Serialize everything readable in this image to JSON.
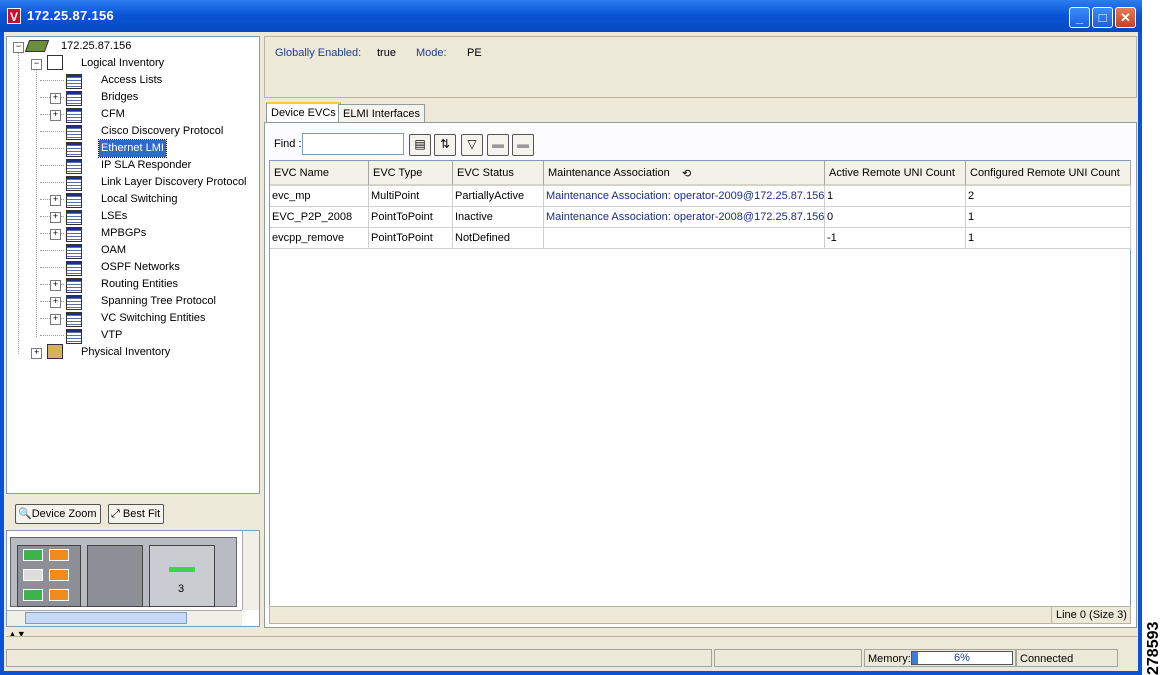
{
  "window": {
    "title": "172.25.87.156",
    "logo": "V"
  },
  "tree": {
    "root": "172.25.87.156",
    "logical": "Logical Inventory",
    "items": [
      {
        "label": "Access Lists",
        "expandable": false
      },
      {
        "label": "Bridges",
        "expandable": true
      },
      {
        "label": "CFM",
        "expandable": true
      },
      {
        "label": "Cisco Discovery Protocol",
        "expandable": false
      },
      {
        "label": "Ethernet LMI",
        "expandable": false,
        "selected": true
      },
      {
        "label": "IP SLA Responder",
        "expandable": false
      },
      {
        "label": "Link Layer Discovery Protocol",
        "expandable": false
      },
      {
        "label": "Local Switching",
        "expandable": true
      },
      {
        "label": "LSEs",
        "expandable": true
      },
      {
        "label": "MPBGPs",
        "expandable": true
      },
      {
        "label": "OAM",
        "expandable": false
      },
      {
        "label": "OSPF Networks",
        "expandable": false
      },
      {
        "label": "Routing Entities",
        "expandable": true
      },
      {
        "label": "Spanning Tree Protocol",
        "expandable": true
      },
      {
        "label": "VC Switching Entities",
        "expandable": true
      },
      {
        "label": "VTP",
        "expandable": false
      }
    ],
    "physical": "Physical Inventory"
  },
  "zoom": {
    "device_zoom": "Device Zoom",
    "best_fit": "Best Fit"
  },
  "thumbnail": {
    "slot_label": "3"
  },
  "info": {
    "globally_enabled_label": "Globally Enabled:",
    "globally_enabled_value": "true",
    "mode_label": "Mode:",
    "mode_value": "PE"
  },
  "tabs": [
    "Device EVCs",
    "ELMI Interfaces"
  ],
  "find_label": "Find :",
  "table": {
    "columns": [
      "EVC Name",
      "EVC Type",
      "EVC Status",
      "Maintenance Association",
      "Active Remote UNI Count",
      "Configured Remote UNI Count"
    ],
    "rows": [
      [
        "evc_mp",
        "MultiPoint",
        "PartiallyActive",
        "Maintenance Association: operator-2009@172.25.87.156",
        "1",
        "2"
      ],
      [
        "EVC_P2P_2008",
        "PointToPoint",
        "Inactive",
        "Maintenance Association: operator-2008@172.25.87.156",
        "0",
        "1"
      ],
      [
        "evcpp_remove",
        "PointToPoint",
        "NotDefined",
        "",
        "-1",
        "1"
      ]
    ],
    "status": "Line 0 (Size 3)"
  },
  "statusbar": {
    "memory_label": "Memory:",
    "memory_value": "6%",
    "memory_fraction": 0.06,
    "connection": "Connected"
  },
  "side_number": "278593"
}
